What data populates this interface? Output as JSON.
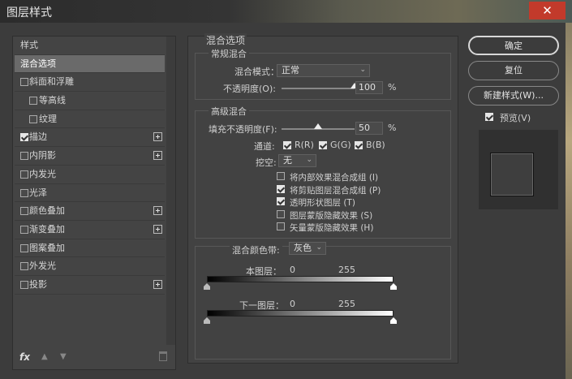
{
  "window": {
    "title": "图层样式",
    "close": "✕"
  },
  "left_panel": {
    "header": "样式",
    "items": [
      {
        "label": "混合选项",
        "type": "selected"
      },
      {
        "label": "斜面和浮雕",
        "checked": false,
        "plus": false,
        "sub": false
      },
      {
        "label": "等高线",
        "checked": false,
        "plus": false,
        "sub": true
      },
      {
        "label": "纹理",
        "checked": false,
        "plus": false,
        "sub": true
      },
      {
        "label": "描边",
        "checked": true,
        "plus": true,
        "sub": false
      },
      {
        "label": "内阴影",
        "checked": false,
        "plus": true,
        "sub": false
      },
      {
        "label": "内发光",
        "checked": false,
        "plus": false,
        "sub": false
      },
      {
        "label": "光泽",
        "checked": false,
        "plus": false,
        "sub": false
      },
      {
        "label": "颜色叠加",
        "checked": false,
        "plus": true,
        "sub": false
      },
      {
        "label": "渐变叠加",
        "checked": false,
        "plus": true,
        "sub": false
      },
      {
        "label": "图案叠加",
        "checked": false,
        "plus": false,
        "sub": false
      },
      {
        "label": "外发光",
        "checked": false,
        "plus": false,
        "sub": false
      },
      {
        "label": "投影",
        "checked": false,
        "plus": true,
        "sub": false
      }
    ],
    "fx_label": "fx"
  },
  "blend": {
    "section_title": "混合选项",
    "general_title": "常规混合",
    "mode_label": "混合模式：",
    "mode_value": "正常",
    "opacity_label": "不透明度(O):",
    "opacity_value": "100",
    "opacity_fraction": 1.0,
    "pct": "%",
    "advanced_title": "高级混合",
    "fill_label": "填充不透明度(F):",
    "fill_value": "50",
    "fill_fraction": 0.5,
    "channels_label": "通道:",
    "channels": [
      {
        "label": "R(R)",
        "checked": true
      },
      {
        "label": "G(G)",
        "checked": true
      },
      {
        "label": "B(B)",
        "checked": true
      }
    ],
    "knockout_label": "挖空:",
    "knockout_value": "无",
    "options": [
      {
        "label": "将内部效果混合成组 (I)",
        "checked": false
      },
      {
        "label": "将剪贴图层混合成组 (P)",
        "checked": true
      },
      {
        "label": "透明形状图层 (T)",
        "checked": true
      },
      {
        "label": "图层蒙版隐藏效果 (S)",
        "checked": false
      },
      {
        "label": "矢量蒙版隐藏效果 (H)",
        "checked": false
      }
    ],
    "band_label": "混合颜色带:",
    "band_value": "灰色",
    "this_layer_label": "本图层：",
    "underlying_label": "下一图层：",
    "range_min": "0",
    "range_max": "255"
  },
  "buttons": {
    "ok": "确定",
    "reset": "复位",
    "new_style": "新建样式(W)...",
    "preview_label": "预览(V)",
    "preview_checked": true
  }
}
